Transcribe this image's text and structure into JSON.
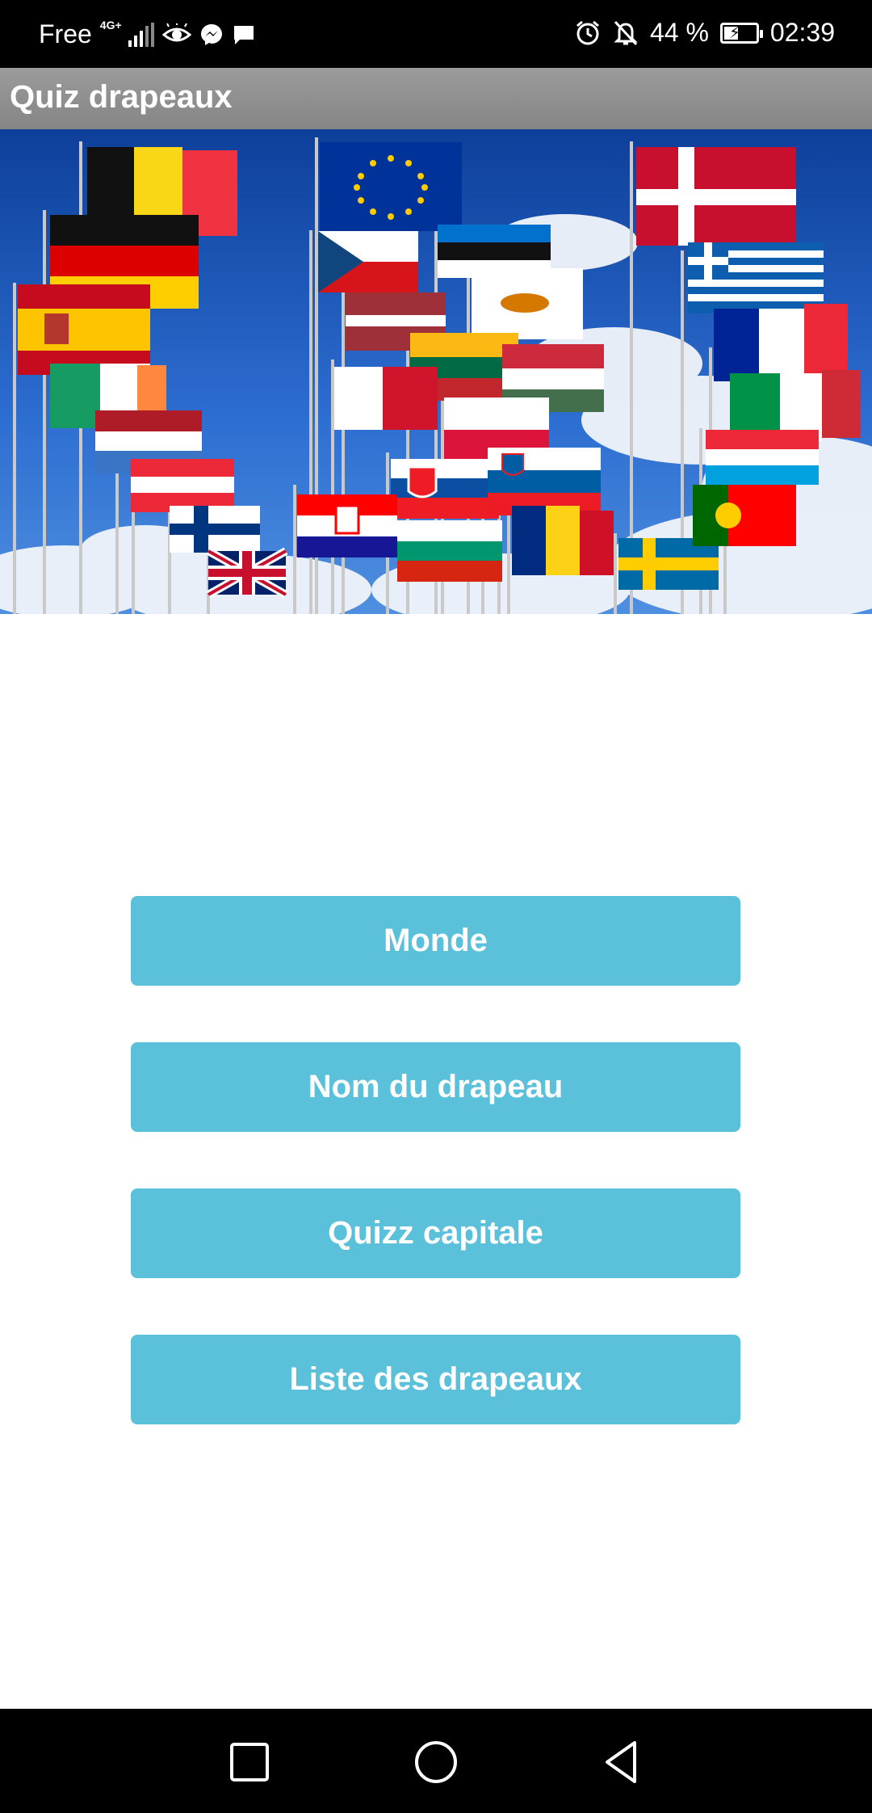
{
  "status_bar": {
    "carrier": "Free",
    "network": "4G+",
    "battery": "44 %",
    "battery_level": 0.44,
    "time": "02:39",
    "icons_left": [
      "signal-icon",
      "eye-icon",
      "messenger-icon",
      "message-icon"
    ],
    "icons_right": [
      "alarm-icon",
      "bell-off-icon",
      "battery-icon"
    ]
  },
  "app_bar": {
    "title": "Quiz drapeaux"
  },
  "banner": {
    "description_icon": "flags-banner-image"
  },
  "menu": {
    "buttons": [
      {
        "label": "Monde"
      },
      {
        "label": "Nom du drapeau"
      },
      {
        "label": "Quizz capitale"
      },
      {
        "label": "Liste des drapeaux"
      }
    ],
    "button_color": "#5bc0da"
  },
  "nav_bar": {
    "icons": [
      "recent-apps-icon",
      "home-icon",
      "back-icon"
    ]
  }
}
